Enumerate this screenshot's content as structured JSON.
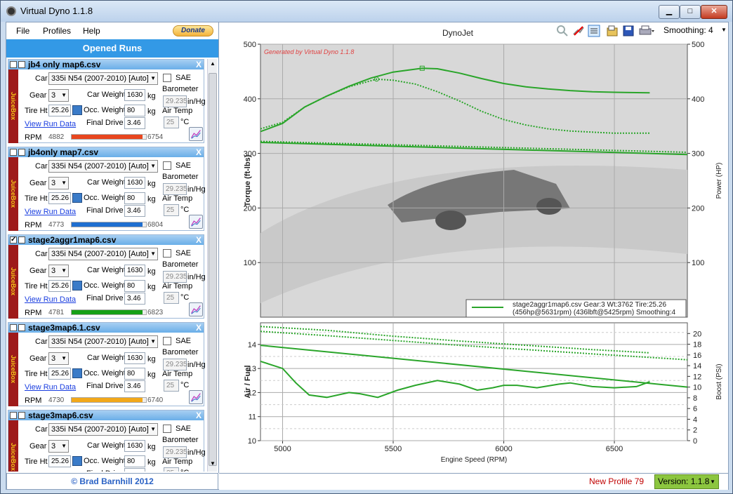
{
  "window": {
    "title": "Virtual Dyno 1.1.8",
    "min": "▁",
    "max": "□",
    "close": "✕"
  },
  "menu": {
    "file": "File",
    "profiles": "Profiles",
    "help": "Help",
    "donate": "Donate"
  },
  "sidebar": {
    "header": "Opened Runs",
    "footer": "© Brad Barnhill 2012",
    "labels": {
      "car": "Car",
      "sae": "SAE",
      "gear": "Gear",
      "car_weight": "Car Weight",
      "kg": "kg",
      "barometer": "Barometer",
      "inhg": "in/Hg",
      "tire_ht": "Tire Ht",
      "occ_weight": "Occ. Weight",
      "air_temp": "Air Temp",
      "degc": "°C",
      "view_run_data": "View Run Data",
      "final_drive": "Final Drive",
      "rpm": "RPM",
      "juicebox": "JuiceBox"
    },
    "runs": [
      {
        "name": "jb4 only map6.csv",
        "checked": false,
        "car": "335i N54 (2007-2010) [Auto]",
        "gear": "3",
        "car_weight": "1630",
        "tire_ht": "25.26",
        "occ_weight": "80",
        "barometer": "29.235",
        "air_temp": "25",
        "final_drive": "3.46",
        "rpm_start": "4882",
        "rpm_end": "6754",
        "rpm_fraction": 0.95,
        "color": "#e8461e"
      },
      {
        "name": "jb4only  map7.csv",
        "checked": false,
        "car": "335i N54 (2007-2010) [Auto]",
        "gear": "3",
        "car_weight": "1630",
        "tire_ht": "25.26",
        "occ_weight": "80",
        "barometer": "29.235",
        "air_temp": "25",
        "final_drive": "3.46",
        "rpm_start": "4773",
        "rpm_end": "6804",
        "rpm_fraction": 0.95,
        "color": "#1f6fd0"
      },
      {
        "name": "stage2aggr1map6.csv",
        "checked": true,
        "car": "335i N54 (2007-2010) [Auto]",
        "gear": "3",
        "car_weight": "1630",
        "tire_ht": "25.26",
        "occ_weight": "80",
        "barometer": "29.235",
        "air_temp": "25",
        "final_drive": "3.46",
        "rpm_start": "4781",
        "rpm_end": "6823",
        "rpm_fraction": 0.95,
        "color": "#16a016"
      },
      {
        "name": "stage3map6.1.csv",
        "checked": false,
        "car": "335i N54 (2007-2010) [Auto]",
        "gear": "3",
        "car_weight": "1630",
        "tire_ht": "25.26",
        "occ_weight": "80",
        "barometer": "29.235",
        "air_temp": "25",
        "final_drive": "3.46",
        "rpm_start": "4730",
        "rpm_end": "6740",
        "rpm_fraction": 0.95,
        "color": "#f2a81a"
      },
      {
        "name": "stage3map6.csv",
        "checked": false,
        "car": "335i N54 (2007-2010) [Auto]",
        "gear": "3",
        "car_weight": "1630",
        "tire_ht": "25.26",
        "occ_weight": "80",
        "barometer": "29.235",
        "air_temp": "25",
        "final_drive": "",
        "rpm_start": "",
        "rpm_end": "",
        "rpm_fraction": 0,
        "color": "#999999"
      }
    ]
  },
  "toolbar": {
    "smoothing": "Smoothing: 4",
    "icons": [
      "zoom-icon",
      "clear-icon",
      "legend-icon",
      "open-icon",
      "save-icon",
      "print-icon"
    ]
  },
  "status": {
    "profile": "New Profile 79",
    "version": "Version: 1.1.8"
  },
  "chart_data": [
    {
      "type": "line",
      "title": "DynoJet",
      "watermark": "Generated by Virtual Dyno 1.1.8",
      "xlim": [
        4900,
        6830
      ],
      "ylim_left": [
        0,
        500
      ],
      "ylim_right": [
        0,
        500
      ],
      "ylabel": "Torque (ft-lbs)",
      "ylabel_right": "Power (HP)",
      "y_ticks": [
        100,
        200,
        300,
        400,
        500
      ],
      "grid": true,
      "legend": {
        "placement": "bottom-right",
        "line1": "stage2aggr1map6.csv Gear:3 Wt:3762 Tire:25.26",
        "line2": "(456hp@5631rpm) (436lbft@5425rpm) Smoothing:4"
      },
      "series": [
        {
          "name": "power",
          "style": "solid",
          "x": [
            4900,
            5000,
            5100,
            5200,
            5300,
            5400,
            5500,
            5631,
            5700,
            5800,
            5900,
            6000,
            6100,
            6200,
            6300,
            6400,
            6500,
            6660
          ],
          "y": [
            340,
            355,
            385,
            405,
            423,
            438,
            449,
            456,
            455,
            447,
            437,
            428,
            422,
            418,
            415,
            413,
            412,
            411
          ]
        },
        {
          "name": "torque",
          "style": "dotted",
          "x": [
            4900,
            5000,
            5100,
            5200,
            5300,
            5425,
            5500,
            5600,
            5700,
            5800,
            5900,
            6000,
            6100,
            6200,
            6300,
            6400,
            6500,
            6660
          ],
          "y": [
            345,
            357,
            385,
            405,
            422,
            436,
            434,
            427,
            413,
            396,
            377,
            362,
            352,
            345,
            341,
            339,
            337,
            337
          ]
        },
        {
          "name": "line3",
          "style": "solid",
          "x": [
            4900,
            6830
          ],
          "y": [
            320,
            298
          ]
        },
        {
          "name": "line4",
          "style": "dotted",
          "x": [
            4900,
            6830
          ],
          "y": [
            322,
            302
          ]
        }
      ]
    },
    {
      "type": "line",
      "xlabel": "Engine Speed (RPM)",
      "ylabel": "Air / Fuel",
      "ylabel_right": "Boost (PSI)",
      "xlim": [
        4900,
        6830
      ],
      "x_ticks": [
        5000,
        5500,
        6000,
        6500
      ],
      "ylim_left": [
        10,
        14.9
      ],
      "y_ticks_left": [
        10,
        11,
        12,
        13,
        14
      ],
      "ylim_right": [
        0,
        22
      ],
      "y_ticks_right": [
        0,
        2,
        4,
        6,
        8,
        10,
        12,
        14,
        16,
        18,
        20
      ],
      "series": [
        {
          "name": "air_fuel",
          "style": "solid",
          "axis": "left",
          "x": [
            4900,
            5000,
            5060,
            5120,
            5200,
            5300,
            5350,
            5430,
            5520,
            5600,
            5700,
            5800,
            5880,
            5950,
            6000,
            6060,
            6150,
            6250,
            6300,
            6400,
            6500,
            6600,
            6660
          ],
          "y": [
            13.3,
            13.0,
            12.4,
            11.9,
            11.8,
            12.0,
            11.95,
            11.8,
            12.1,
            12.3,
            12.5,
            12.35,
            12.1,
            12.2,
            12.3,
            12.3,
            12.2,
            12.35,
            12.4,
            12.25,
            12.2,
            12.25,
            12.45
          ]
        },
        {
          "name": "boost_solid",
          "style": "solid",
          "axis": "right",
          "x": [
            4900,
            6830
          ],
          "y": [
            17.8,
            10.0
          ]
        },
        {
          "name": "boost_dot_a",
          "style": "dotted",
          "axis": "right",
          "x": [
            4900,
            5200,
            5500,
            5800,
            6100,
            6400,
            6660
          ],
          "y": [
            21.3,
            20.6,
            19.5,
            18.6,
            17.8,
            17.0,
            16.4
          ]
        },
        {
          "name": "boost_dot_b",
          "style": "dotted",
          "axis": "right",
          "x": [
            4900,
            5200,
            5500,
            5800,
            6100,
            6400,
            6830
          ],
          "y": [
            20.4,
            19.6,
            18.7,
            17.8,
            17.0,
            16.2,
            15.1
          ]
        }
      ]
    }
  ]
}
